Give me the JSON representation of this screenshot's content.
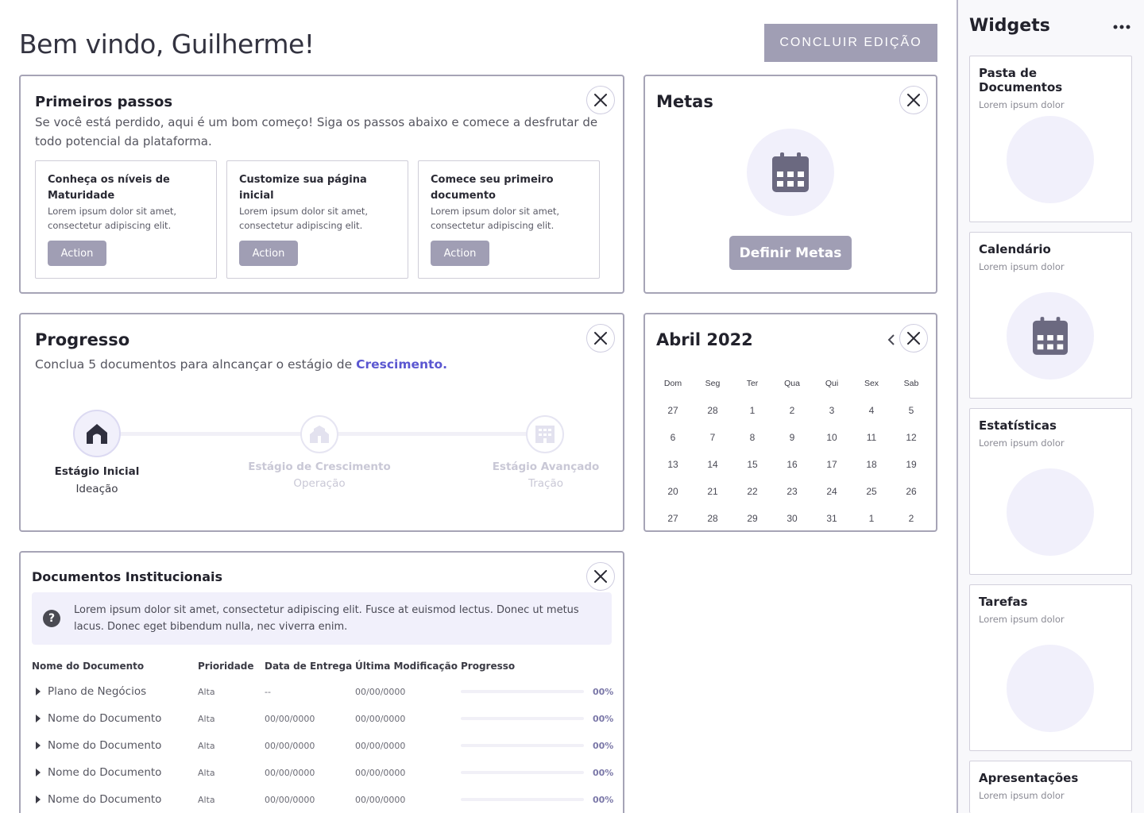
{
  "header": {
    "greeting": "Bem vindo, Guilherme!",
    "conclude_button": "CONCLUIR EDIÇÃO"
  },
  "first_steps": {
    "title": "Primeiros passos",
    "subtitle": "Se você está perdido, aqui é um bom começo! Siga os passos abaixo e comece a desfrutar de todo potencial da plataforma.",
    "steps": [
      {
        "title": "Conheça os níveis de Maturidade",
        "desc": "Lorem ipsum dolor sit amet, consectetur adipiscing elit.",
        "action": "Action"
      },
      {
        "title": "Customize sua página inicial",
        "desc": "Lorem ipsum dolor sit amet, consectetur adipiscing elit.",
        "action": "Action"
      },
      {
        "title": "Comece seu primeiro documento",
        "desc": "Lorem ipsum dolor sit amet, consectetur adipiscing elit.",
        "action": "Action"
      }
    ]
  },
  "goals": {
    "title": "Metas",
    "icon": "calendar-icon",
    "button": "Definir Metas"
  },
  "progress": {
    "title": "Progresso",
    "text_prefix": "Conclua 5 documentos para alncançar o estágio de ",
    "text_highlight": "Crescimento.",
    "completion": 0.02,
    "stages": [
      {
        "name": "Estágio Inicial",
        "sub": "Ideação",
        "icon": "house-icon",
        "active": true
      },
      {
        "name": "Estágio de Crescimento",
        "sub": "Operação",
        "icon": "buildings-icon",
        "active": false
      },
      {
        "name": "Estágio Avançado",
        "sub": "Tração",
        "icon": "office-building-icon",
        "active": false
      }
    ]
  },
  "calendar": {
    "title": "Abril 2022",
    "weekdays": [
      "Dom",
      "Seg",
      "Ter",
      "Qua",
      "Qui",
      "Sex",
      "Sab"
    ],
    "weeks": [
      [
        "27",
        "28",
        "1",
        "2",
        "3",
        "4",
        "5"
      ],
      [
        "6",
        "7",
        "8",
        "9",
        "10",
        "11",
        "12"
      ],
      [
        "13",
        "14",
        "15",
        "16",
        "17",
        "18",
        "19"
      ],
      [
        "20",
        "21",
        "22",
        "23",
        "24",
        "25",
        "26"
      ],
      [
        "27",
        "28",
        "29",
        "30",
        "31",
        "1",
        "2"
      ]
    ]
  },
  "documents": {
    "title": "Documentos Institucionais",
    "info": "Lorem ipsum dolor sit amet, consectetur adipiscing elit. Fusce at euismod lectus. Donec ut metus lacus. Donec eget bibendum nulla, nec viverra enim.",
    "columns": [
      "Nome do Documento",
      "Prioridade",
      "Data de Entrega",
      "Última Modificação",
      "Progresso"
    ],
    "rows": [
      {
        "name": "Plano de Negócios",
        "priority": "Alta",
        "due": "--",
        "modified": "00/00/0000",
        "progress": "00%",
        "progress_value": 0
      },
      {
        "name": "Nome do Documento",
        "priority": "Alta",
        "due": "00/00/0000",
        "modified": "00/00/0000",
        "progress": "00%",
        "progress_value": 0
      },
      {
        "name": "Nome do Documento",
        "priority": "Alta",
        "due": "00/00/0000",
        "modified": "00/00/0000",
        "progress": "00%",
        "progress_value": 0
      },
      {
        "name": "Nome do Documento",
        "priority": "Alta",
        "due": "00/00/0000",
        "modified": "00/00/0000",
        "progress": "00%",
        "progress_value": 0
      },
      {
        "name": "Nome do Documento",
        "priority": "Alta",
        "due": "00/00/0000",
        "modified": "00/00/0000",
        "progress": "00%",
        "progress_value": 0
      }
    ]
  },
  "sidebar": {
    "title": "Widgets",
    "menu_icon": "more-horizontal-icon",
    "widgets": [
      {
        "title": "Pasta de Documentos",
        "sub": "Lorem ipsum dolor",
        "icon": ""
      },
      {
        "title": "Calendário",
        "sub": "Lorem ipsum dolor",
        "icon": "calendar-icon"
      },
      {
        "title": "Estatísticas",
        "sub": "Lorem ipsum dolor",
        "icon": ""
      },
      {
        "title": "Tarefas",
        "sub": "Lorem ipsum dolor",
        "icon": ""
      },
      {
        "title": "Apresentações",
        "sub": "Lorem ipsum dolor",
        "icon": ""
      }
    ]
  },
  "colors": {
    "accent": "#5b57d1",
    "button": "#a09eb4",
    "border": "#a6a4b6",
    "lavender": "#f1f0fb",
    "icon": "#6b6980"
  }
}
